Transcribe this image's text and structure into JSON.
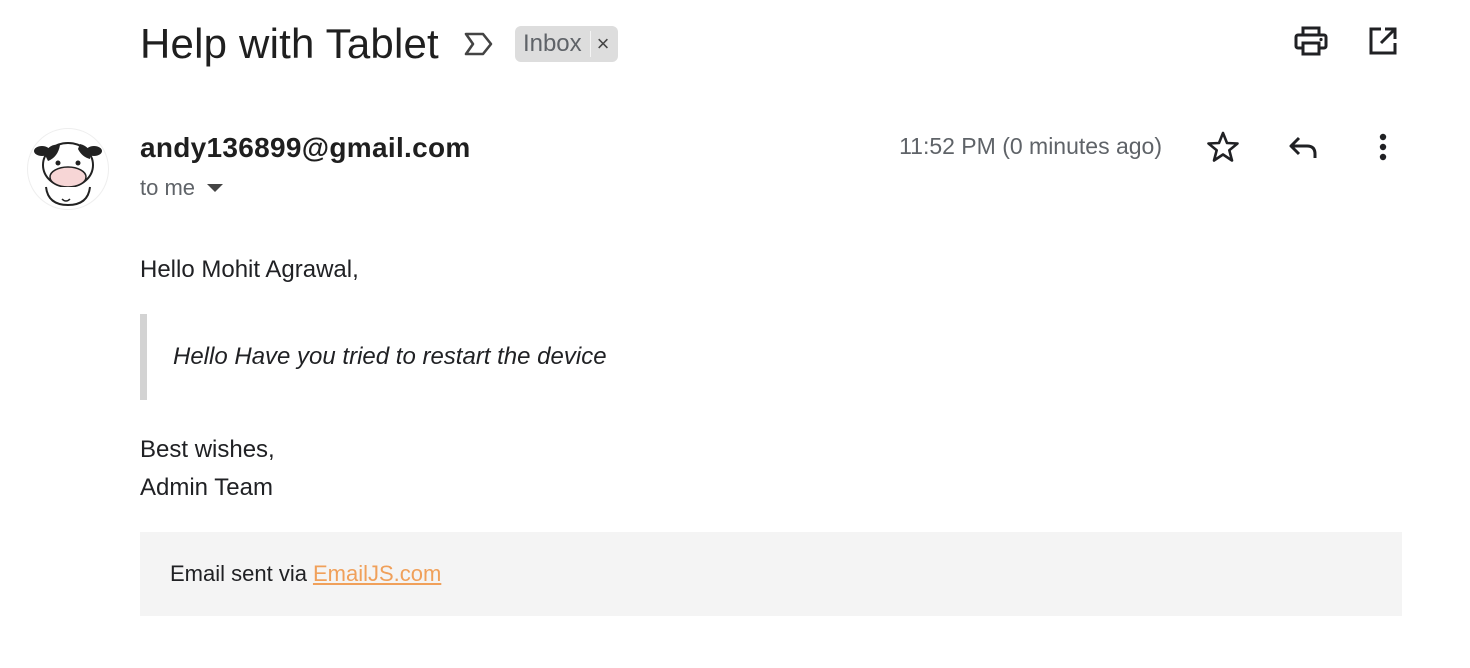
{
  "email": {
    "subject": "Help with Tablet",
    "label": "Inbox",
    "label_close": "×",
    "sender": "andy136899@gmail.com",
    "recipient": "to me",
    "timestamp": "11:52 PM (0 minutes ago)",
    "greeting": "Hello Mohit Agrawal,",
    "quote": "Hello Have you tried to restart the device",
    "signoff_line1": "Best wishes,",
    "signoff_line2": "Admin Team",
    "footer_prefix": "Email sent via",
    "footer_link": "EmailJS.com"
  },
  "icons": {
    "importance": "importance-marker-icon",
    "print": "print-icon",
    "open_new_window": "open-in-new-window-icon",
    "star": "star-icon",
    "reply": "reply-icon",
    "more": "more-vert-icon",
    "avatar": "cow-avatar"
  },
  "colors": {
    "link": "#f0a05a",
    "chip_bg": "#dddddd",
    "footer_bg": "#f4f4f4",
    "quote_border": "#d3d3d3"
  }
}
